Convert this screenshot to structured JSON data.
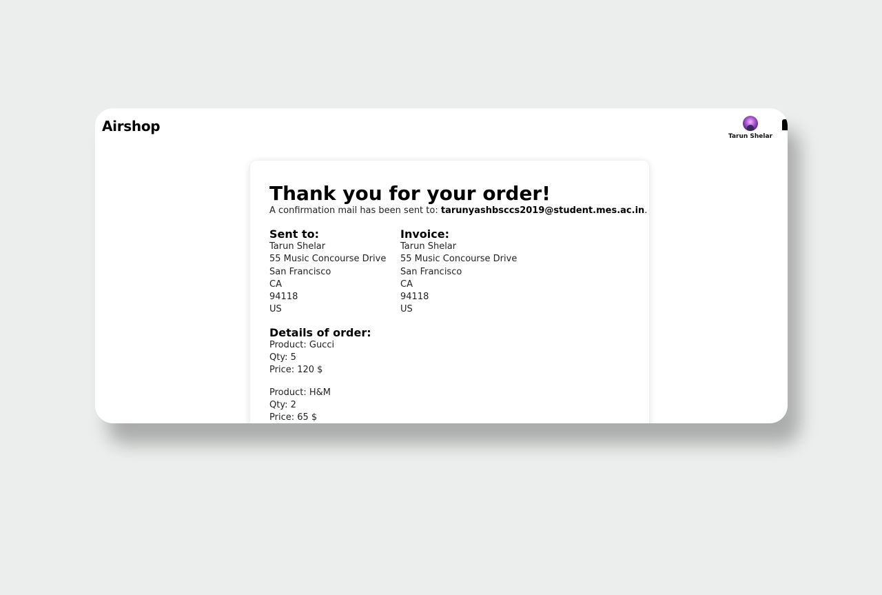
{
  "header": {
    "brand": "Airshop",
    "user_name": "Tarun Shelar"
  },
  "confirmation": {
    "title": "Thank you for your order!",
    "message_prefix": "A confirmation mail has been sent to: ",
    "email": "tarunyashbsccs2019@student.mes.ac.in",
    "message_suffix": "."
  },
  "sent_to": {
    "heading": "Sent to:",
    "lines": [
      "Tarun Shelar",
      "55 Music Concourse Drive",
      "San Francisco",
      "CA",
      "94118",
      "US"
    ]
  },
  "invoice": {
    "heading": "Invoice:",
    "lines": [
      "Tarun Shelar",
      "55 Music Concourse Drive",
      "San Francisco",
      "CA",
      "94118",
      "US"
    ]
  },
  "order_details": {
    "heading": "Details of order:",
    "items": [
      {
        "product": "Product: Gucci",
        "qty": "Qty: 5",
        "price": "Price: 120 $"
      },
      {
        "product": "Product: H&M",
        "qty": "Qty: 2",
        "price": "Price: 65 $"
      }
    ]
  }
}
